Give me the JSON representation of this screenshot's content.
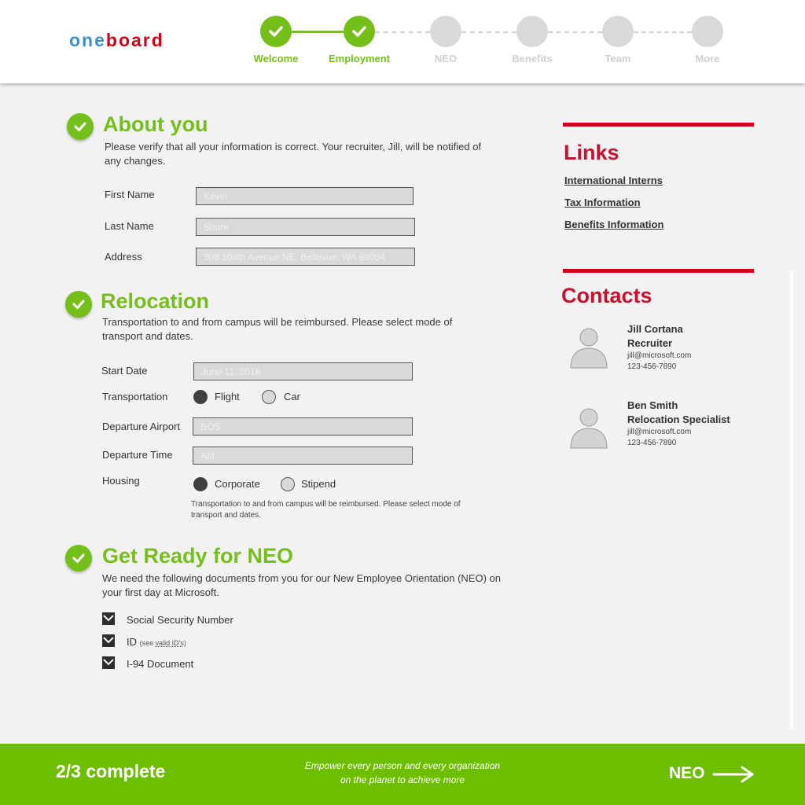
{
  "app": {
    "logo_part1": "one",
    "logo_part2": "board"
  },
  "steps": [
    {
      "label": "Welcome",
      "status": "done"
    },
    {
      "label": "Employment",
      "status": "done"
    },
    {
      "label": "NEO",
      "status": "todo"
    },
    {
      "label": "Benefits",
      "status": "todo"
    },
    {
      "label": "Team",
      "status": "todo"
    },
    {
      "label": "More",
      "status": "todo"
    }
  ],
  "about": {
    "title": "About you",
    "description": "Please verify that all your information is correct. Your recruiter, Jill, will be notified of any changes.",
    "first_name_label": "First Name",
    "first_name_value": "Kevin",
    "last_name_label": "Last Name",
    "last_name_value": "Shum",
    "address_label": "Address",
    "address_value": "308 108th Avenue NE, Bellevue, WA 98004"
  },
  "relocation": {
    "title": "Relocation",
    "description": "Transportation to and from campus will be reimbursed. Please select mode of transport and dates.",
    "start_date_label": "Start Date",
    "start_date_value": "June 11, 2018",
    "transportation_label": "Transportation",
    "transport_options": [
      {
        "label": "Flight",
        "selected": true
      },
      {
        "label": "Car",
        "selected": false
      }
    ],
    "airport_label": "Departure Airport",
    "airport_value": "BOS",
    "time_label": "Departure  Time",
    "time_value": "AM",
    "housing_label": "Housing",
    "housing_options": [
      {
        "label": "Corporate",
        "selected": true
      },
      {
        "label": "Stipend",
        "selected": false
      }
    ],
    "note": "Transportation to and from campus will be reimbursed. Please select mode of transport and dates."
  },
  "neo": {
    "title": "Get Ready for NEO",
    "description": "We need the following documents from you for our New Employee Orientation (NEO) on your first day at Microsoft.",
    "documents": [
      {
        "label": "Social Security Number",
        "checked": true
      },
      {
        "label": "ID",
        "checked": true
      },
      {
        "label": "I-94 Document",
        "checked": true
      }
    ],
    "id_hint_prefix": "(see ",
    "id_hint_link": "valid ID's",
    "id_hint_suffix": ")"
  },
  "links": {
    "title": "Links",
    "items": [
      "International Interns",
      "Tax Information",
      "Benefits Information"
    ]
  },
  "contacts": {
    "title": "Contacts",
    "people": [
      {
        "name": "Jill Cortana",
        "role": "Recruiter",
        "email": "jill@microsoft.com",
        "phone": "123-456-7890"
      },
      {
        "name": "Ben Smith",
        "role": "Relocation Specialist",
        "email": "jill@microsoft.com",
        "phone": "123-456-7890"
      }
    ]
  },
  "footer": {
    "progress": "2/3 complete",
    "tagline_line1": "Empower every person and every organization",
    "tagline_line2": "on the planet to achieve more",
    "next_label": "NEO"
  },
  "colors": {
    "accent_green": "#74bf1a",
    "footer_green": "#6ebe00",
    "brand_red": "#d0021b",
    "logo_blue": "#3f8fd7",
    "pending_gray": "#d9d9d9"
  },
  "icons": {
    "step_done": "check-icon",
    "section_done": "check-circle-icon",
    "contact": "user-avatar-icon",
    "next": "arrow-right-icon",
    "checkbox": "checkbox-checked-icon"
  }
}
